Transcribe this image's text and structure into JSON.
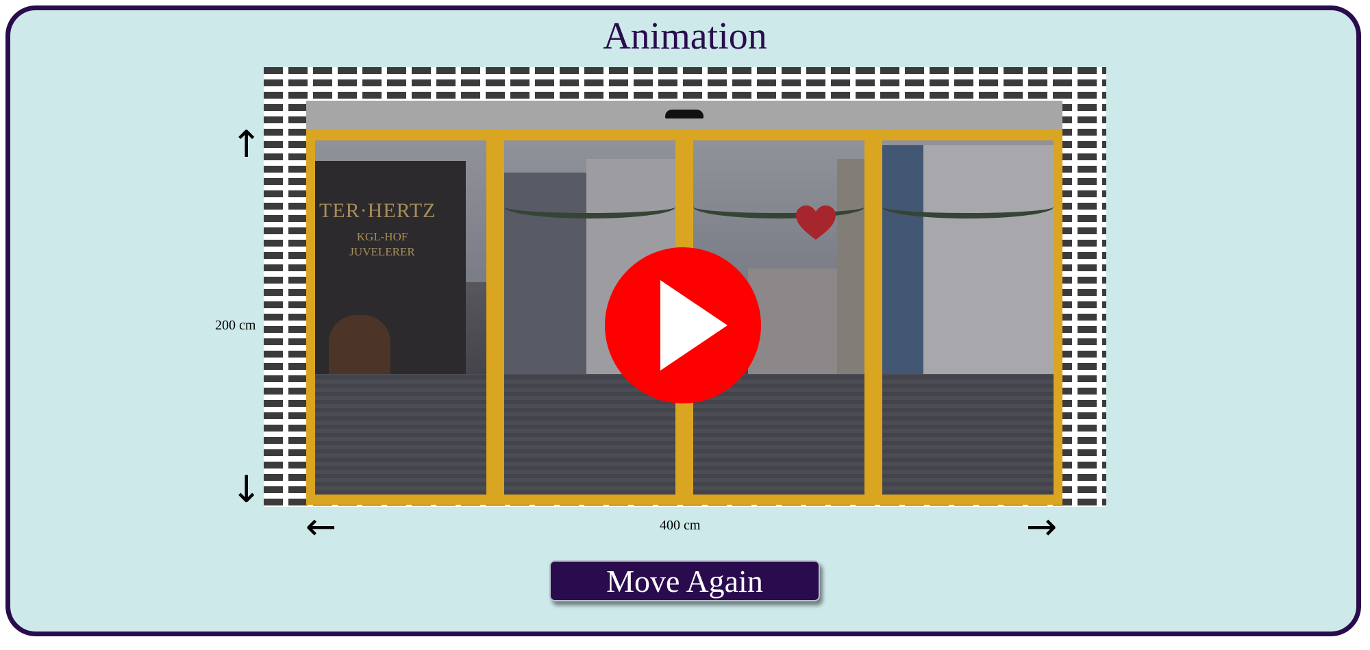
{
  "page": {
    "title": "Animation"
  },
  "door": {
    "height_label": "200 cm",
    "width_label": "400 cm",
    "pane_count": 4,
    "frame_color": "#daa520",
    "header_color": "#a6a6a6",
    "wall_color": "#3b3b3b"
  },
  "scene": {
    "shop_sign": "TER·HERTZ",
    "shop_sign_sub": "KGL-HOF JUVELERER"
  },
  "video": {
    "play_icon": "play-icon",
    "play_color": "#ff0000"
  },
  "controls": {
    "move_again_label": "Move Again"
  },
  "icons": {
    "arrow_up": "↑",
    "arrow_down": "↓",
    "arrow_left": "←",
    "arrow_right": "→"
  },
  "theme": {
    "background": "#cde9ea",
    "accent": "#2a0c4e"
  }
}
